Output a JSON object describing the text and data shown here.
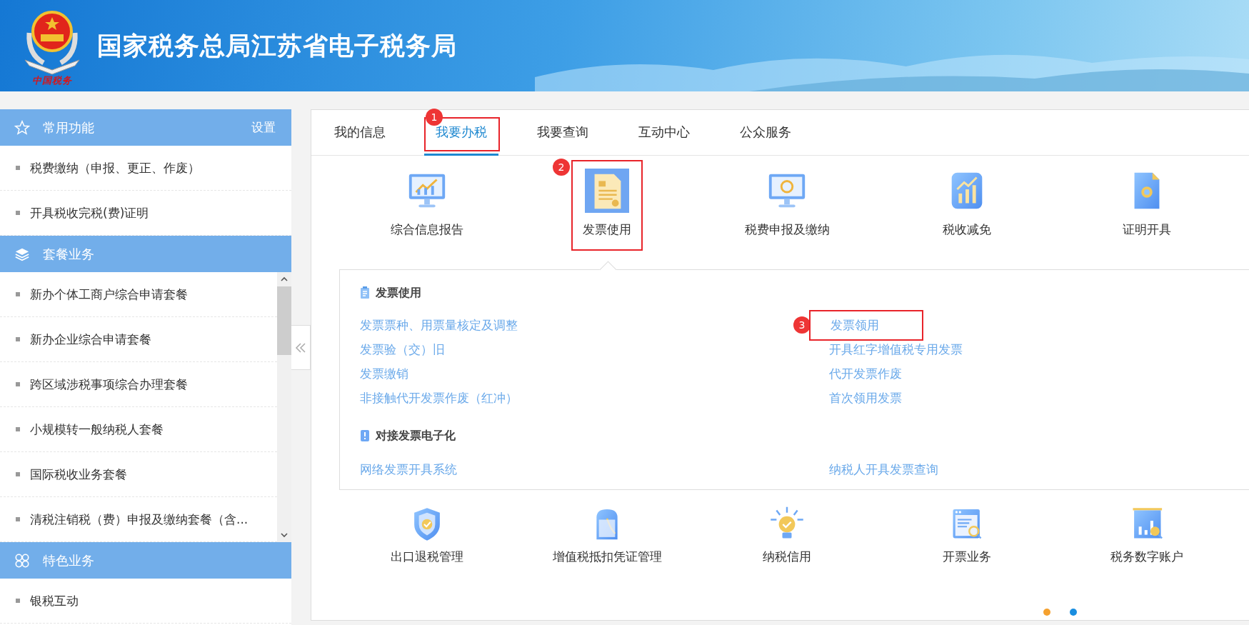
{
  "header": {
    "title": "国家税务总局江苏省电子税务局",
    "emblem_caption": "中国税务"
  },
  "sidebar": {
    "sections": [
      {
        "title": "常用功能",
        "action": "设置",
        "scrollable": false,
        "items": [
          "税费缴纳（申报、更正、作废）",
          "开具税收完税(费)证明"
        ]
      },
      {
        "title": "套餐业务",
        "scrollable": true,
        "items": [
          "新办个体工商户综合申请套餐",
          "新办企业综合申请套餐",
          "跨区域涉税事项综合办理套餐",
          "小规模转一般纳税人套餐",
          "国际税收业务套餐",
          "清税注销税（费）申报及缴纳套餐（含..."
        ]
      },
      {
        "title": "特色业务",
        "scrollable": false,
        "items": [
          "银税互动"
        ]
      }
    ]
  },
  "tabs": [
    {
      "label": "我的信息",
      "selected": false
    },
    {
      "label": "我要办税",
      "selected": true,
      "marker": "1"
    },
    {
      "label": "我要查询",
      "selected": false
    },
    {
      "label": "互动中心",
      "selected": false
    },
    {
      "label": "公众服务",
      "selected": false
    }
  ],
  "services": [
    {
      "label": "综合信息报告",
      "selected": false
    },
    {
      "label": "发票使用",
      "selected": true,
      "marker": "2"
    },
    {
      "label": "税费申报及缴纳",
      "selected": false
    },
    {
      "label": "税收减免",
      "selected": false
    },
    {
      "label": "证明开具",
      "selected": false
    }
  ],
  "popup": {
    "groups": [
      {
        "title": "发票使用",
        "links": [
          {
            "label": "发票票种、用票量核定及调整"
          },
          {
            "label": "发票领用",
            "marker": "3"
          },
          {
            "label": "发票验（交）旧"
          },
          {
            "label": "开具红字增值税专用发票"
          },
          {
            "label": "发票缴销"
          },
          {
            "label": "代开发票作废"
          },
          {
            "label": "非接触代开发票作废（红冲）"
          },
          {
            "label": "首次领用发票"
          }
        ]
      },
      {
        "title": "对接发票电子化",
        "links": [
          {
            "label": "网络发票开具系统"
          },
          {
            "label": "纳税人开具发票查询"
          }
        ]
      }
    ]
  },
  "more_services": [
    {
      "label": "出口退税管理"
    },
    {
      "label": "增值税抵扣凭证管理"
    },
    {
      "label": "纳税信用"
    },
    {
      "label": "开票业务"
    },
    {
      "label": "税务数字账户"
    }
  ],
  "pager": [
    {
      "selected": true
    },
    {
      "selected": false
    }
  ]
}
